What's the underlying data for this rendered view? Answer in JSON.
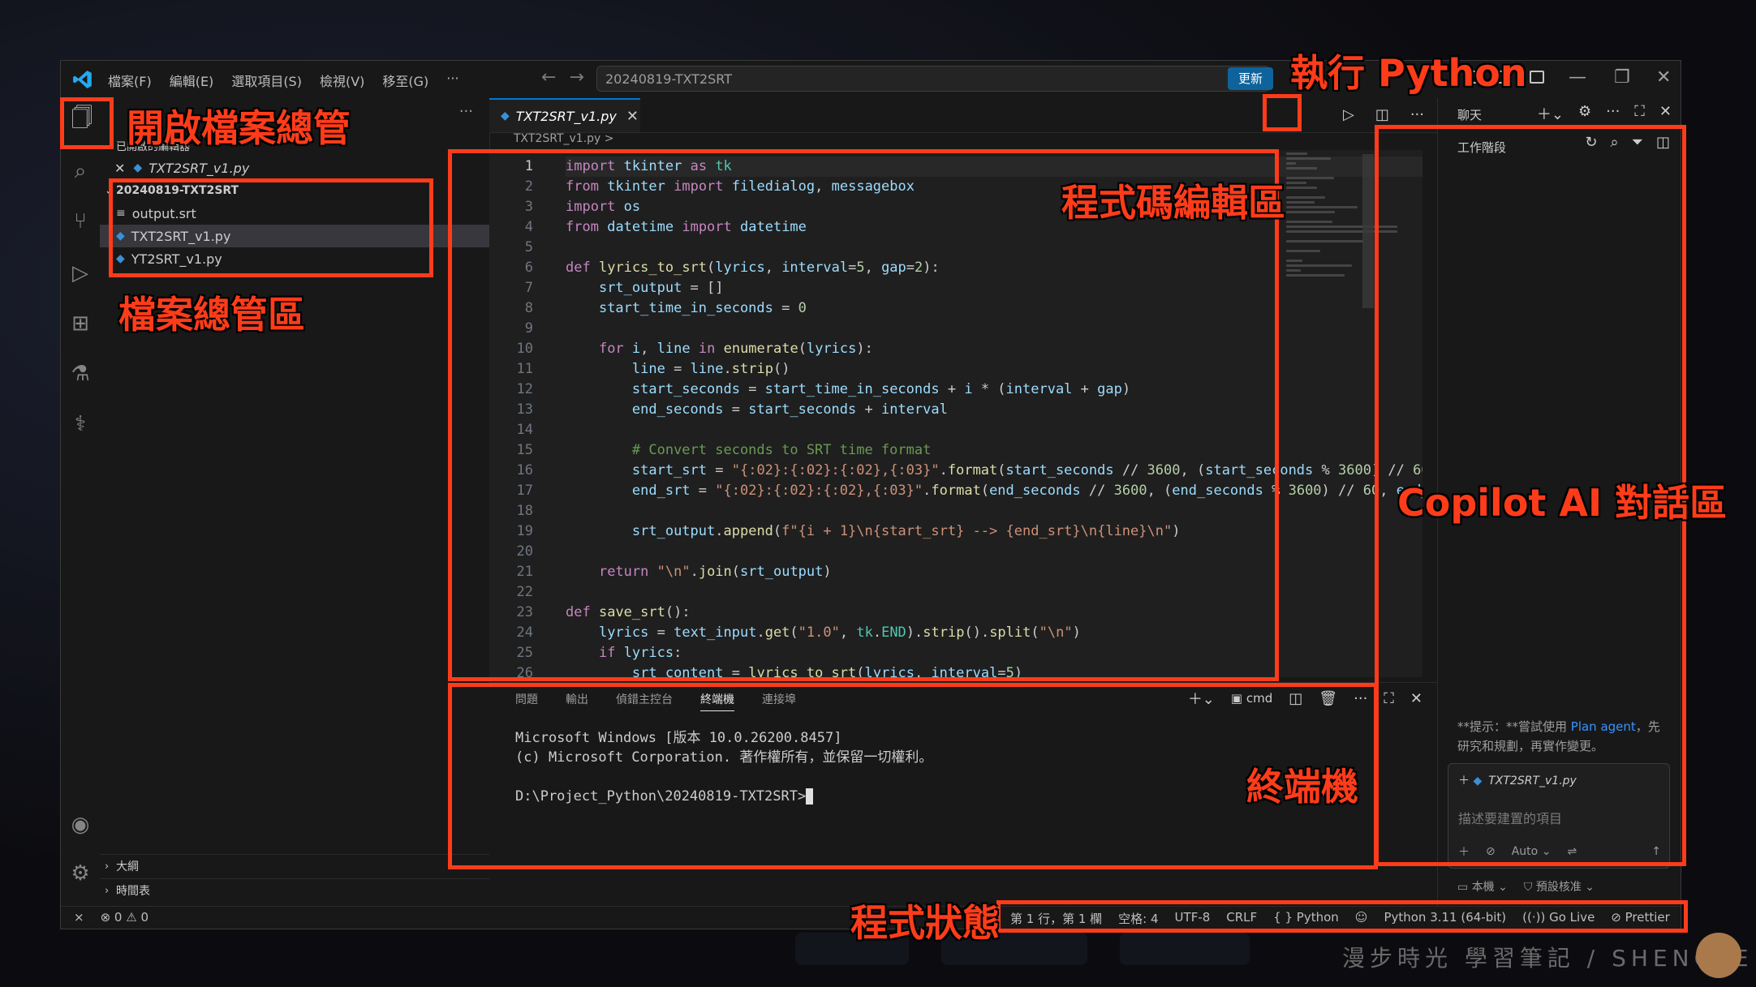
{
  "menu": [
    "檔案(F)",
    "編輯(E)",
    "選取項目(S)",
    "檢視(V)",
    "移至(G)",
    "···"
  ],
  "title": {
    "search": "20240819-TXT2SRT",
    "update_label": "更新"
  },
  "explorer": {
    "open_editors_label": "已開啟的編輯器",
    "open_file": "TXT2SRT_v1.py",
    "folder": "20240819-TXT2SRT",
    "files": [
      "output.srt",
      "TXT2SRT_v1.py",
      "YT2SRT_v1.py"
    ],
    "outline": "大綱",
    "timeline": "時間表"
  },
  "editor": {
    "tab": "TXT2SRT_v1.py",
    "breadcrumb": "TXT2SRT_v1.py >",
    "lines": [
      "import tkinter as tk",
      "from tkinter import filedialog, messagebox",
      "import os",
      "from datetime import datetime",
      "",
      "def lyrics_to_srt(lyrics, interval=5, gap=2):",
      "    srt_output = []",
      "    start_time_in_seconds = 0",
      "",
      "    for i, line in enumerate(lyrics):",
      "        line = line.strip()",
      "        start_seconds = start_time_in_seconds + i * (interval + gap)",
      "        end_seconds = start_seconds + interval",
      "",
      "        # Convert seconds to SRT time format",
      "        start_srt = \"{:02}:{:02}:{:02},{:03}\".format(start_seconds // 3600, (start_seconds % 3600) // 60,",
      "        end_srt = \"{:02}:{:02}:{:02},{:03}\".format(end_seconds // 3600, (end_seconds % 3600) // 60, end_s",
      "",
      "        srt_output.append(f\"{i + 1}\\n{start_srt} --> {end_srt}\\n{line}\\n\")",
      "",
      "    return \"\\n\".join(srt_output)",
      "",
      "def save_srt():",
      "    lyrics = text_input.get(\"1.0\", tk.END).strip().split(\"\\n\")",
      "    if lyrics:",
      "        srt_content = lyrics_to_srt(lyrics, interval=5)"
    ]
  },
  "panel": {
    "tabs": [
      "問題",
      "輸出",
      "偵錯主控台",
      "終端機",
      "連接埠"
    ],
    "active_tab": "終端機",
    "shell": "cmd",
    "terminal": [
      "Microsoft Windows [版本 10.0.26200.8457]",
      "(c) Microsoft Corporation. 著作權所有，並保留一切權利。",
      "",
      "D:\\Project_Python\\20240819-TXT2SRT>"
    ]
  },
  "chat": {
    "title": "聊天",
    "session": "工作階段",
    "hint_prefix": "**提示：**嘗試使用 ",
    "hint_link": "Plan agent",
    "hint_suffix": "，先研究和規劃，再實作變更。",
    "context_file": "TXT2SRT_v1.py",
    "placeholder": "描述要建置的項目",
    "mode": "Auto",
    "foot_left": "本機",
    "foot_right": "預設核准"
  },
  "status": {
    "errors": "0",
    "warnings": "0",
    "position": "第 1 行，第 1 欄",
    "spaces": "空格: 4",
    "encoding": "UTF-8",
    "eol": "CRLF",
    "language": "Python",
    "interpreter": "Python 3.11 (64-bit)",
    "golive": "Go Live",
    "prettier": "Prettier"
  },
  "annotations": {
    "explorer_open": "開啟檔案總管",
    "explorer_area": "檔案總管區",
    "run_python": "執行 Python",
    "code_editor": "程式碼編輯區",
    "copilot": "Copilot AI 對話區",
    "terminal": "終端機",
    "status": "程式狀態"
  },
  "watermark": "漫步時光 學習筆記 / SHENGLE",
  "colors": {
    "accent": "#0078d4",
    "annotation": "#ff3c1a"
  }
}
